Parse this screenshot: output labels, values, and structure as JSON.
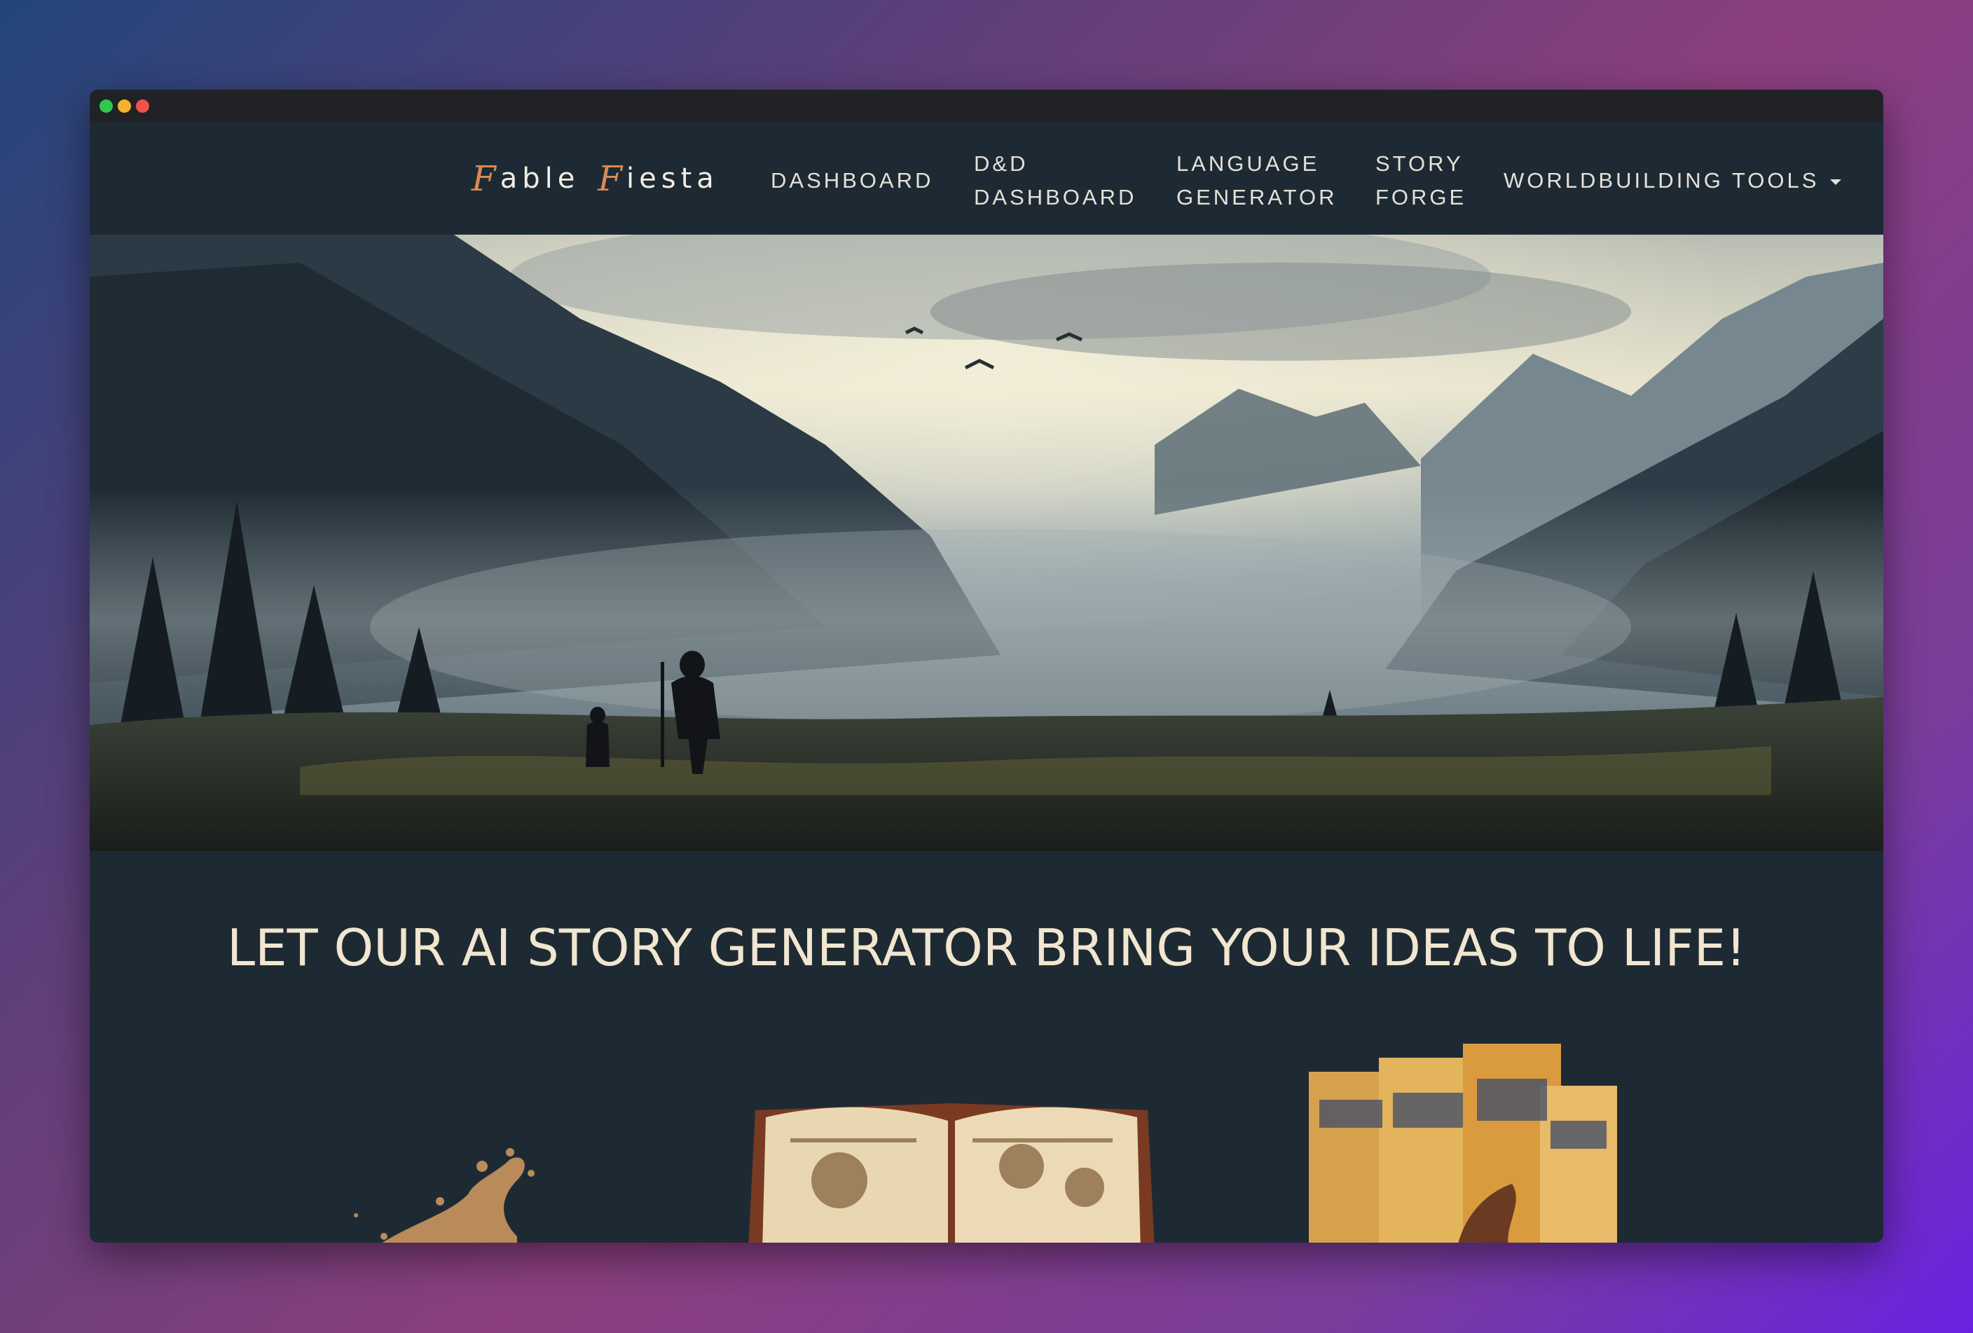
{
  "brand": {
    "cap1": "F",
    "rest1": "able",
    "cap2": "F",
    "rest2": "iesta"
  },
  "nav": {
    "dashboard": "DASHBOARD",
    "dnd_line1": "D&D",
    "dnd_line2": "DASHBOARD",
    "lang_line1": "LANGUAGE",
    "lang_line2": "GENERATOR",
    "story_line1": "STORY",
    "story_line2": "FORGE",
    "worldbuilding": "WORLDBUILDING TOOLS"
  },
  "hero": {
    "alt": "misty mountain valley with wanderer and dog"
  },
  "main": {
    "headline": "LET OUR AI STORY GENERATOR BRING YOUR IDEAS TO LIFE!"
  },
  "colors": {
    "navbar_bg": "#1e2a33",
    "headline": "#f1e6cf",
    "brand_accent": "#d98a55"
  }
}
